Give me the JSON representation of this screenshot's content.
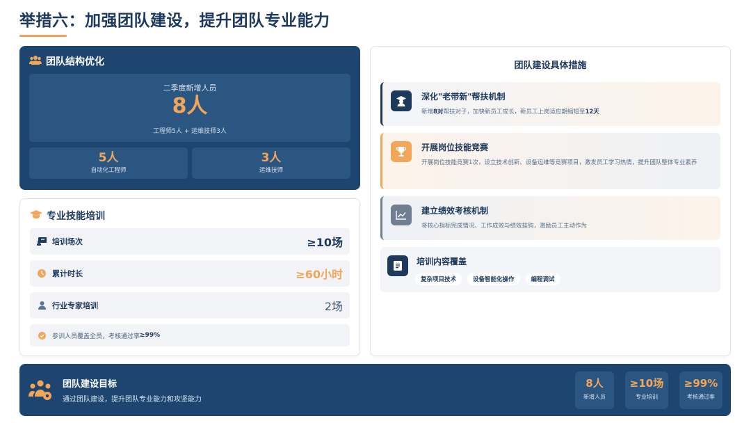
{
  "header": {
    "title": "举措六：加强团队建设，提升团队专业能力"
  },
  "structure": {
    "heading": "团队结构优化",
    "new_label": "二季度新增人员",
    "new_value": "8人",
    "new_detail": "工程师5人 + 运维技师3人",
    "sub": [
      {
        "value": "5人",
        "label": "自动化工程师"
      },
      {
        "value": "3人",
        "label": "运维技师"
      }
    ]
  },
  "training": {
    "heading": "专业技能培训",
    "rows": [
      {
        "icon": "chalkboard-icon",
        "label": "培训场次",
        "value": "≥10场"
      },
      {
        "icon": "clock-icon",
        "label": "累计时长",
        "value": "≥60小时"
      },
      {
        "icon": "user-icon",
        "label": "行业专家培训",
        "value": "2场"
      }
    ],
    "note_prefix": "参训人员覆盖全员，考核通过率",
    "note_value": "≥99%"
  },
  "measures": {
    "title": "团队建设具体措施",
    "items": [
      {
        "icon": "mentor-icon",
        "title": "深化\"老带新\"帮扶机制",
        "desc_1": "新增",
        "desc_bold_1": "8对",
        "desc_2": "帮扶对子，加快新员工成长，新员工上岗适应期缩短至",
        "desc_bold_2": "12天"
      },
      {
        "icon": "trophy-icon",
        "title": "开展岗位技能竞赛",
        "desc": "开展岗位技能竞赛1次，设立技术创新、设备运维等竞赛项目，激发员工学习热情，提升团队整体专业素养"
      },
      {
        "icon": "chart-line-icon",
        "title": "建立绩效考核机制",
        "desc": "将核心指标完成情况、工作成效与绩效挂钩，激励员工主动作为"
      },
      {
        "icon": "document-icon",
        "title": "培训内容覆盖",
        "tags": [
          "复杂项目技术",
          "设备智能化操作",
          "编程调试"
        ]
      }
    ]
  },
  "goal": {
    "title": "团队建设目标",
    "desc": "通过团队建设，提升团队专业能力和攻坚能力",
    "stats": [
      {
        "value": "8人",
        "label": "新增人员"
      },
      {
        "value": "≥10场",
        "label": "专业培训"
      },
      {
        "value": "≥99%",
        "label": "考核通过率"
      }
    ]
  },
  "colors": {
    "navy": "#1d4570",
    "accent": "#f2a65a",
    "dark_text": "#1d3a5c"
  }
}
